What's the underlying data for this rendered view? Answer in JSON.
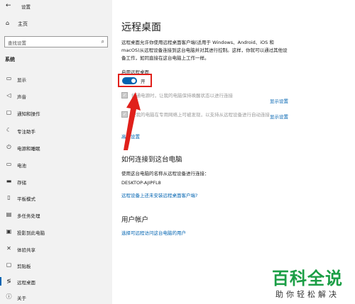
{
  "window": {
    "title": "设置"
  },
  "sidebar": {
    "home": "主页",
    "search_placeholder": "查找设置",
    "section": "系统",
    "items": [
      {
        "label": "显示",
        "icon": "monitor-icon"
      },
      {
        "label": "声音",
        "icon": "speaker-icon"
      },
      {
        "label": "通知和操作",
        "icon": "notification-icon"
      },
      {
        "label": "专注助手",
        "icon": "moon-icon"
      },
      {
        "label": "电源和睡眠",
        "icon": "power-icon"
      },
      {
        "label": "电池",
        "icon": "battery-icon"
      },
      {
        "label": "存储",
        "icon": "storage-icon"
      },
      {
        "label": "平板模式",
        "icon": "tablet-icon"
      },
      {
        "label": "多任务处理",
        "icon": "multitask-icon"
      },
      {
        "label": "投影到此电脑",
        "icon": "project-icon"
      },
      {
        "label": "体验共享",
        "icon": "share-icon"
      },
      {
        "label": "剪贴板",
        "icon": "clipboard-icon"
      },
      {
        "label": "远程桌面",
        "icon": "remote-icon",
        "active": true
      },
      {
        "label": "关于",
        "icon": "info-icon"
      }
    ]
  },
  "main": {
    "title": "远程桌面",
    "description": "远程桌面允许你使用远程桌面客户端(适用于 Windows、Android、iOS 和 macOS)从远程设备连接到这台电脑并对其进行控制。这样，你就可以通过其他设备工作，如同直接在这台电脑上工作一样。",
    "toggle_label": "启用远程桌面",
    "toggle_state": "开",
    "accent": "#0063b1",
    "options": [
      {
        "text": "接通电源时，让我的电脑保持唤醒状态以进行连接",
        "link": "显示设置"
      },
      {
        "text": "使我的电脑在专用网络上可被发现，以支持从远程设备进行自动连接",
        "link": "显示设置"
      }
    ],
    "advanced_link": "高级设置",
    "how_title": "如何连接到这台电脑",
    "how_desc": "使用这台电脑的名称从远程设备进行连接：",
    "pc_name": "DESKTOP-AJIPFL8",
    "no_client_link": "远程设备上还未安装远程桌面客户端?",
    "accounts_title": "用户帐户",
    "accounts_link": "选择可远程访问这台电脑的用户"
  },
  "watermark": {
    "main": "百科全说",
    "sub": "助你轻松解决"
  }
}
